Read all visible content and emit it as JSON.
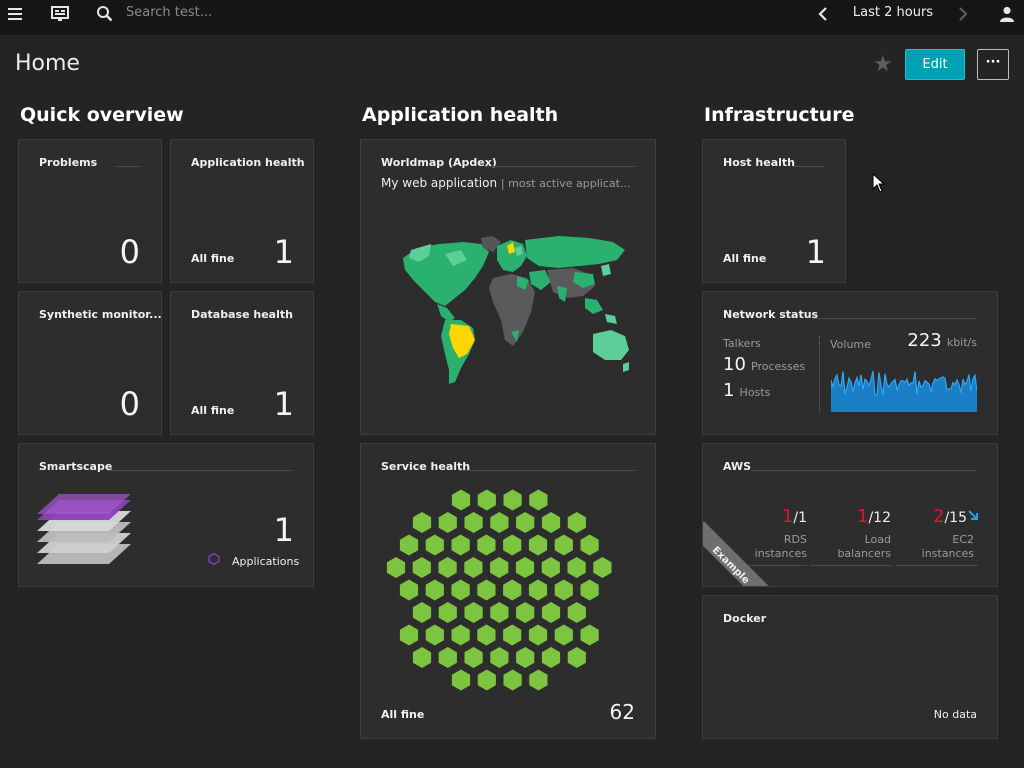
{
  "topbar": {
    "search_placeholder": "Search test...",
    "timeframe": "Last 2 hours"
  },
  "page": {
    "title": "Home",
    "edit_label": "Edit",
    "more_label": "···"
  },
  "sections": {
    "quick_overview": "Quick overview",
    "application_health": "Application health",
    "infrastructure": "Infrastructure"
  },
  "tiles": {
    "problems": {
      "title": "Problems",
      "value": "0"
    },
    "application_health": {
      "title": "Application health",
      "status": "All fine",
      "value": "1"
    },
    "synthetic": {
      "title": "Synthetic monitor...",
      "value": "0"
    },
    "database_health": {
      "title": "Database health",
      "status": "All fine",
      "value": "1"
    },
    "smartscape": {
      "title": "Smartscape",
      "value": "1",
      "legend": "Applications"
    },
    "worldmap": {
      "title": "Worldmap (Apdex)",
      "app_name": "My web application",
      "app_note": "| most active applicat..."
    },
    "service_health": {
      "title": "Service health",
      "status": "All fine",
      "value": "62",
      "hex_count": 62
    },
    "host_health": {
      "title": "Host health",
      "status": "All fine",
      "value": "1"
    },
    "network_status": {
      "title": "Network status",
      "talkers_label": "Talkers",
      "processes_value": "10",
      "processes_label": "Processes",
      "hosts_value": "1",
      "hosts_label": "Hosts",
      "volume_label": "Volume",
      "volume_value": "223",
      "volume_unit": "kbit/s"
    },
    "aws": {
      "title": "AWS",
      "ribbon": "Example",
      "items": [
        {
          "value": "1",
          "total": "/1",
          "line1": "RDS",
          "line2": "instances"
        },
        {
          "value": "1",
          "total": "/12",
          "line1": "Load",
          "line2": "balancers"
        },
        {
          "value": "2",
          "total": "/15",
          "line1": "EC2",
          "line2": "instances"
        }
      ]
    },
    "docker": {
      "title": "Docker",
      "status": "No data"
    }
  },
  "colors": {
    "accent": "#00a1b2",
    "healthy": "#7dc540",
    "problem": "#dc172a",
    "worldmap_green": "#2ab06f",
    "worldmap_lightgreen": "#5ccf98",
    "worldmap_yellow": "#ffd500",
    "smartscape_purple": "#8b3fb8"
  }
}
